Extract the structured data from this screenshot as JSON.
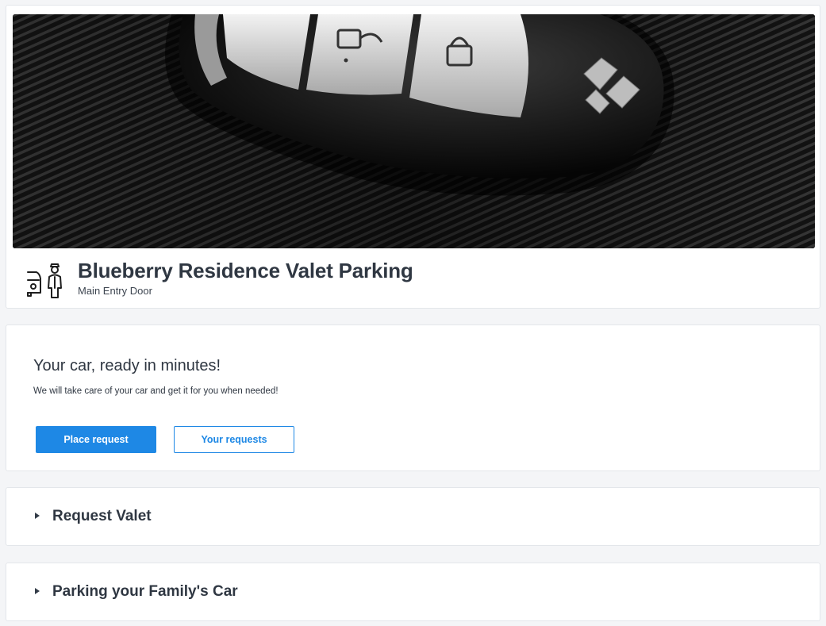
{
  "venue": {
    "title": "Blueberry Residence Valet Parking",
    "subtitle": "Main Entry Door",
    "icon": "valet-attendant-car-icon",
    "hero_image": "car-key-fob-photo"
  },
  "hero_card": {
    "heading": "Your car, ready in minutes!",
    "description": "We will take care of your car and get it for you when needed!",
    "primary_button": "Place request",
    "secondary_button": "Your requests"
  },
  "sections": [
    {
      "label": "Request Valet",
      "icon": "caret-right-icon",
      "expanded": false
    },
    {
      "label": "Parking your Family's Car",
      "icon": "caret-right-icon",
      "expanded": false
    }
  ],
  "colors": {
    "accent": "#1e88e5",
    "text": "#2f3742",
    "background": "#f4f5f7",
    "card": "#ffffff"
  }
}
